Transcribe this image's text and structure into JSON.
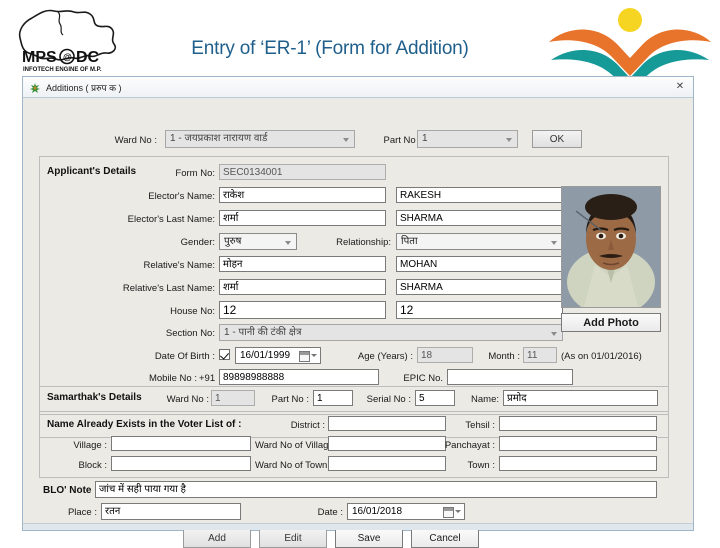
{
  "slide": {
    "title": "Entry of ‘ER-1’ (Form for Addition)",
    "logo_left_text": "MPS©DC",
    "logo_left_sub": "INFOTECH ENGINE OF M.P.",
    "title_color": "#1f5f8b"
  },
  "window": {
    "titlebar": "Additions ( प्ररुप क )",
    "close_label": "✕"
  },
  "topbar": {
    "ward_no_label": "Ward No :",
    "ward_no_value": "1 - जयप्रकाश नारायण वार्ड",
    "part_no_label": "Part No :",
    "part_no_value": "1",
    "ok_label": "OK"
  },
  "applicant": {
    "section_title": "Applicant's Details",
    "form_no_label": "Form No:",
    "form_no_value": "SEC0134001",
    "elector_name_label": "Elector's Name:",
    "elector_name_hi": "राकेश",
    "elector_name_en": "RAKESH",
    "elector_last_label": "Elector's Last Name:",
    "elector_last_hi": "शर्मा",
    "elector_last_en": "SHARMA",
    "gender_label": "Gender:",
    "gender_value": "पुरुष",
    "relationship_label": "Relationship:",
    "relationship_value": "पिता",
    "relative_name_label": "Relative's Name:",
    "relative_name_hi": "मोहन",
    "relative_name_en": "MOHAN",
    "relative_last_label": "Relative's Last Name:",
    "relative_last_hi": "शर्मा",
    "relative_last_en": "SHARMA",
    "house_no_label": "House No:",
    "house_no_value_1": "12",
    "house_no_value_2": "12",
    "section_no_label": "Section No:",
    "section_no_value": "1 - पानी की टंकी क्षेत्र",
    "dob_label": "Date Of Birth :",
    "dob_value": "16/01/1999",
    "age_label": "Age (Years) :",
    "age_value": "18",
    "month_label": "Month :",
    "month_value": "11",
    "as_on_text": "(As on 01/01/2016)",
    "mobile_label": "Mobile No :",
    "mobile_prefix": "+91",
    "mobile_value": "89898988888",
    "epic_label": "EPIC No.",
    "epic_value": "",
    "add_photo_label": "Add Photo"
  },
  "samarthak": {
    "section_title": "Samarthak's Details",
    "ward_no_label": "Ward No :",
    "ward_no_value": "1",
    "part_no_label": "Part No :",
    "part_no_value": "1",
    "serial_no_label": "Serial No :",
    "serial_no_value": "5",
    "name_label": "Name:",
    "name_value": "प्रमोद"
  },
  "already_exists": {
    "section_title": "Name Already Exists in the Voter List of :",
    "district_label": "District :",
    "district_value": "",
    "tehsil_label": "Tehsil :",
    "tehsil_value": "",
    "village_label": "Village :",
    "village_value": "",
    "ward_no_village_label": "Ward No of Village :",
    "ward_no_village_value": "",
    "panchayat_label": "Panchayat :",
    "panchayat_value": "",
    "block_label": "Block :",
    "block_value": "",
    "ward_no_town_label": "Ward No of Town :",
    "ward_no_town_value": "",
    "town_label": "Town :",
    "town_value": ""
  },
  "blo": {
    "note_label": "BLO' Note :",
    "note_value": "जांच में सही पाया गया है",
    "place_label": "Place :",
    "place_value": "रतन",
    "date_label": "Date :",
    "date_value": "16/01/2018"
  },
  "actions": {
    "add_label": "Add",
    "edit_label": "Edit",
    "save_label": "Save",
    "cancel_label": "Cancel"
  }
}
